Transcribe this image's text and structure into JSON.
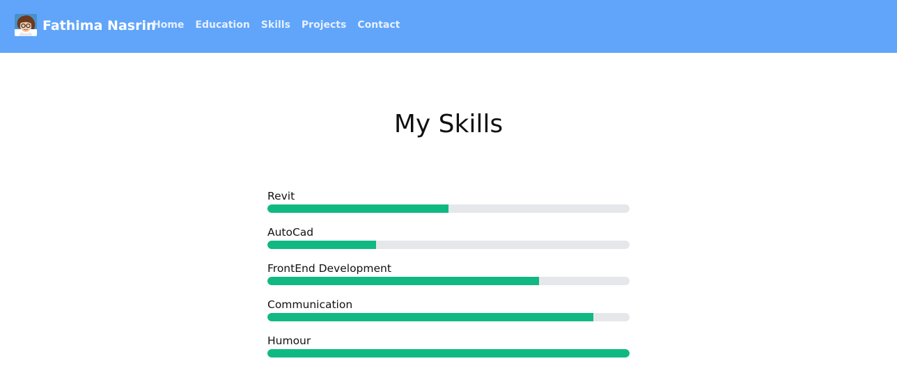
{
  "header": {
    "brand_name": "Fathima Nasrin",
    "nav": [
      {
        "label": "Home"
      },
      {
        "label": "Education"
      },
      {
        "label": "Skills"
      },
      {
        "label": "Projects"
      },
      {
        "label": "Contact"
      }
    ]
  },
  "main": {
    "title": "My Skills",
    "skills": [
      {
        "label": "Revit",
        "percent": 50
      },
      {
        "label": "AutoCad",
        "percent": 30
      },
      {
        "label": "FrontEnd Development",
        "percent": 75
      },
      {
        "label": "Communication",
        "percent": 90
      },
      {
        "label": "Humour",
        "percent": 100
      }
    ]
  },
  "colors": {
    "navbar_bg": "#60a5fa",
    "bar_fill": "#10b981",
    "bar_track": "#e5e7eb"
  }
}
